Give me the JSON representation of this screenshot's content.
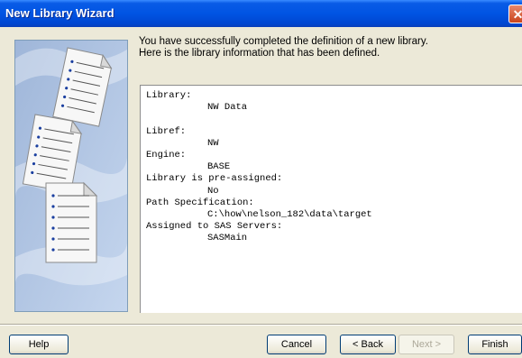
{
  "window": {
    "title": "New Library Wizard",
    "close_glyph": "✕"
  },
  "description": {
    "line1": "You have successfully completed the definition of a new library.",
    "line2": "Here is the library information that has been defined."
  },
  "summary": [
    {
      "text": "Library:",
      "indent": false
    },
    {
      "text": "NW Data",
      "indent": true
    },
    {
      "text": "",
      "indent": false
    },
    {
      "text": "Libref:",
      "indent": false
    },
    {
      "text": "NW",
      "indent": true
    },
    {
      "text": "Engine:",
      "indent": false
    },
    {
      "text": "BASE",
      "indent": true
    },
    {
      "text": "Library is pre-assigned:",
      "indent": false
    },
    {
      "text": "No",
      "indent": true
    },
    {
      "text": "Path Specification:",
      "indent": false
    },
    {
      "text": "C:\\how\\nelson_182\\data\\target",
      "indent": true
    },
    {
      "text": "Assigned to SAS Servers:",
      "indent": false
    },
    {
      "text": "SASMain",
      "indent": true
    }
  ],
  "buttons": {
    "help": "Help",
    "cancel": "Cancel",
    "back": "< Back",
    "next": "Next >",
    "finish": "Finish"
  },
  "icons": {
    "side_image": "documents-illustration-icon",
    "close": "close-icon"
  }
}
